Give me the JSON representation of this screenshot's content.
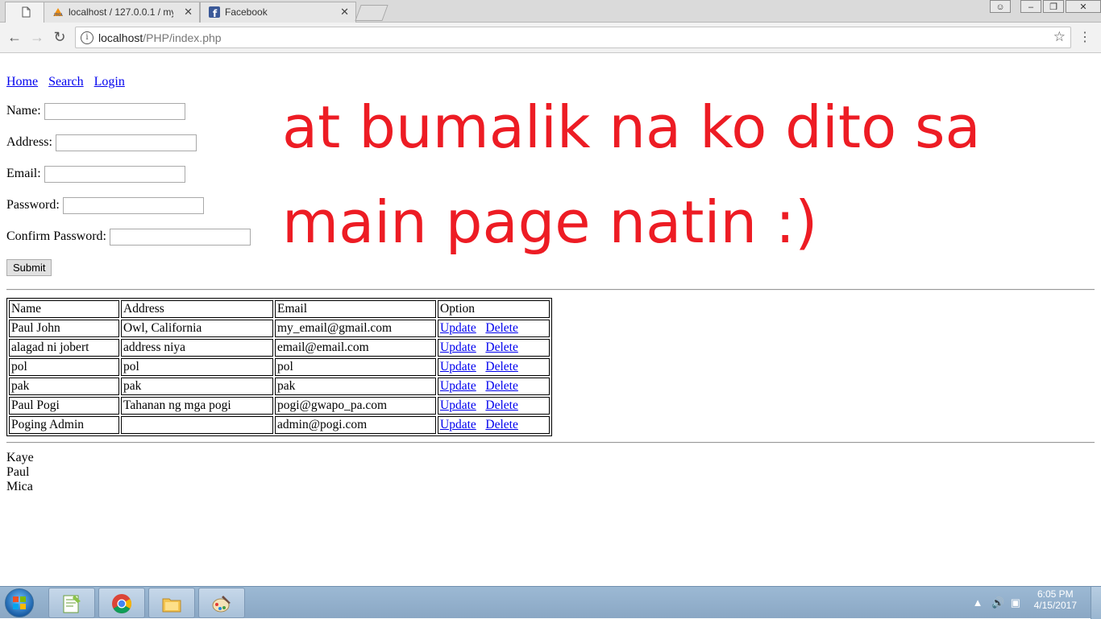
{
  "browser": {
    "tabs": [
      {
        "title": "",
        "icon": "page-icon"
      },
      {
        "title": "localhost / 127.0.0.1 / my",
        "icon": "phpmyadmin-icon"
      },
      {
        "title": "Facebook",
        "icon": "facebook-icon"
      }
    ],
    "url_host": "localhost",
    "url_path": "/PHP/index.php"
  },
  "nav": {
    "home": "Home",
    "search": "Search",
    "login": "Login"
  },
  "form": {
    "name_label": "Name:",
    "address_label": "Address:",
    "email_label": "Email:",
    "password_label": "Password:",
    "confirm_label": "Confirm Password:",
    "submit_label": "Submit"
  },
  "overlay_text": "at bumalik na ko dito sa main page natin :)",
  "overlay_color": "#ed1c24",
  "table": {
    "headers": [
      "Name",
      "Address",
      "Email",
      "Option"
    ],
    "rows": [
      {
        "name": "Paul John",
        "address": "Owl, California",
        "email": "my_email@gmail.com"
      },
      {
        "name": "alagad ni jobert",
        "address": "address niya",
        "email": "email@email.com"
      },
      {
        "name": "pol",
        "address": "pol",
        "email": "pol"
      },
      {
        "name": "pak",
        "address": "pak",
        "email": "pak"
      },
      {
        "name": "Paul Pogi",
        "address": "Tahanan ng mga pogi",
        "email": "pogi@gwapo_pa.com"
      },
      {
        "name": "Poging Admin",
        "address": "",
        "email": "admin@pogi.com"
      }
    ],
    "update_label": "Update",
    "delete_label": "Delete"
  },
  "names_list": [
    "Kaye",
    "Paul",
    "Mica"
  ],
  "taskbar": {
    "items": [
      "notepad-plus-plus-icon",
      "chrome-icon",
      "file-explorer-icon",
      "paint-icon"
    ],
    "time": "6:05 PM",
    "date": "4/15/2017"
  }
}
